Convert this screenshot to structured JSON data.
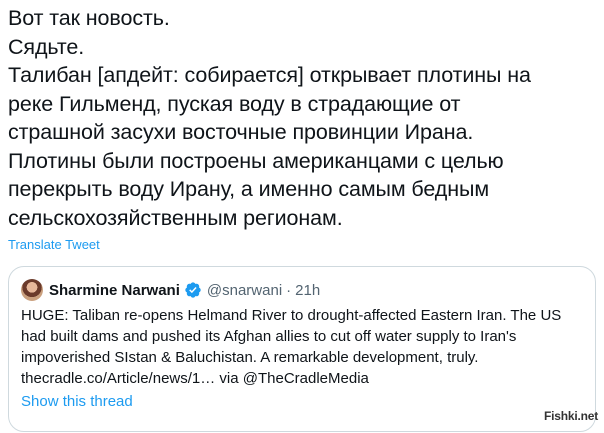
{
  "tweet": {
    "text_lines": [
      "Вот так новость.",
      "Сядьте.",
      "Талибан [апдейт: собирается] открывает плотины на",
      "реке Гильменд, пуская воду в страдающие от",
      "страшной засухи восточные провинции Ирана.",
      "Плотины были построены американцами с целью",
      "перекрыть воду Ирану, а именно самым бедным",
      "сельскохозяйственным регионам."
    ],
    "translate_label": "Translate Tweet"
  },
  "quote": {
    "name": "Sharmine Narwani",
    "handle": "@snarwani",
    "dot": "·",
    "time": "21h",
    "verified": true,
    "avatar_icon": "user-avatar",
    "text_lines": [
      "HUGE: Taliban re-opens Helmand River to drought-affected Eastern Iran. The US",
      "had built dams and pushed its Afghan allies to cut off water supply to Iran's",
      "impoverished SIstan & Baluchistan. A remarkable development, truly.",
      "thecradle.co/Article/news/1… via @TheCradleMedia"
    ],
    "show_thread_label": "Show this thread"
  },
  "watermark": "Fishki.net",
  "colors": {
    "text": "#0f1419",
    "secondary": "#536471",
    "link": "#1d9bf0",
    "border": "#cfd9de"
  }
}
